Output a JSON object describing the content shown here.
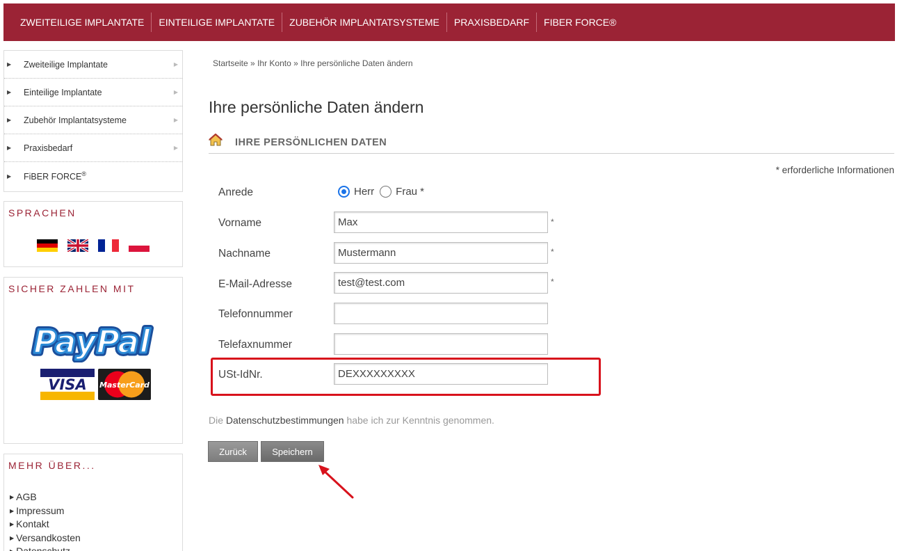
{
  "topnav": {
    "items": [
      "ZWEITEILIGE IMPLANTATE",
      "EINTEILIGE IMPLANTATE",
      "ZUBEHÖR IMPLANTATSYSTEME",
      "PRAXISBEDARF",
      "FIBER FORCE®"
    ]
  },
  "sidebar": {
    "categories": [
      "Zweiteilige Implantate",
      "Einteilige Implantate",
      "Zubehör Implantatsysteme",
      "Praxisbedarf",
      "FiBER FORCE",
      "®"
    ],
    "languages_title": "SPRACHEN",
    "payment_title": "SICHER ZAHLEN MIT",
    "paypal_text": "PayPal",
    "visa_text": "VISA",
    "mastercard_text": "MasterCard",
    "more_title": "MEHR ÜBER...",
    "more_links": [
      "AGB",
      "Impressum",
      "Kontakt",
      "Versandkosten",
      "Datenschutz"
    ]
  },
  "breadcrumb": [
    "Startseite",
    "»",
    "Ihr Konto",
    "»",
    "Ihre persönliche Daten ändern"
  ],
  "page_title": "Ihre persönliche Daten ändern",
  "section_title": "IHRE PERSÖNLICHEN DATEN",
  "required_note": "* erforderliche Informationen",
  "form": {
    "salutation_label": "Anrede",
    "salutation_options": [
      "Herr",
      "Frau *"
    ],
    "salutation_selected": "Herr",
    "firstname_label": "Vorname",
    "firstname_value": "Max",
    "lastname_label": "Nachname",
    "lastname_value": "Mustermann",
    "email_label": "E-Mail-Adresse",
    "email_value": "test@test.com",
    "phone_label": "Telefonnummer",
    "phone_value": "",
    "fax_label": "Telefaxnummer",
    "fax_value": "",
    "vat_label": "USt-IdNr.",
    "vat_value": "DEXXXXXXXXX",
    "required_star": "*"
  },
  "privacy": {
    "prefix": "Die ",
    "link": "Datenschutzbestimmungen",
    "suffix": " habe ich zur Kenntnis genommen."
  },
  "buttons": {
    "back": "Zurück",
    "save": "Speichern"
  },
  "colors": {
    "brand": "#9b2335",
    "highlight": "#d8121c",
    "radio_active": "#1a73e8"
  }
}
